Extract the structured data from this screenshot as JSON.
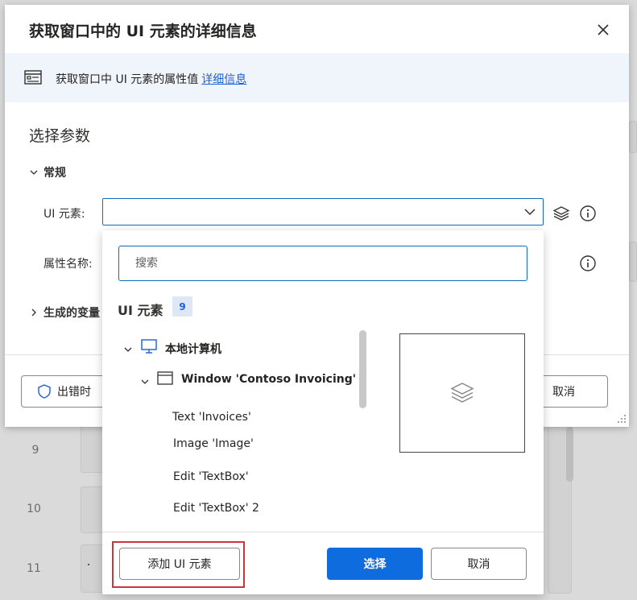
{
  "dialog": {
    "title": "获取窗口中的 UI 元素的详细信息",
    "info_text": "获取窗口中 UI 元素的属性值",
    "info_link": "详细信息",
    "section_title": "选择参数",
    "group_general": "常规",
    "ui_element_label": "UI 元素:",
    "property_label": "属性名称:",
    "variables_group": "生成的变量",
    "on_error_label": "出错时",
    "cancel_label": "取消"
  },
  "background": {
    "line_numbers": [
      "9",
      "10",
      "11"
    ]
  },
  "dropdown": {
    "search_placeholder": "搜索",
    "header": "UI 元素",
    "count": "9",
    "tree": {
      "root": "本地计算机",
      "window": "Window 'Contoso Invoicing'",
      "children": [
        "Text 'Invoices'",
        "Image 'Image'",
        "Edit 'TextBox'",
        "Edit 'TextBox' 2"
      ]
    },
    "add_button": "添加 UI 元素",
    "select_button": "选择",
    "cancel_button": "取消"
  },
  "colors": {
    "accent": "#0f6cdf",
    "highlight": "#d13438",
    "banner_bg": "#f0f5fb"
  }
}
